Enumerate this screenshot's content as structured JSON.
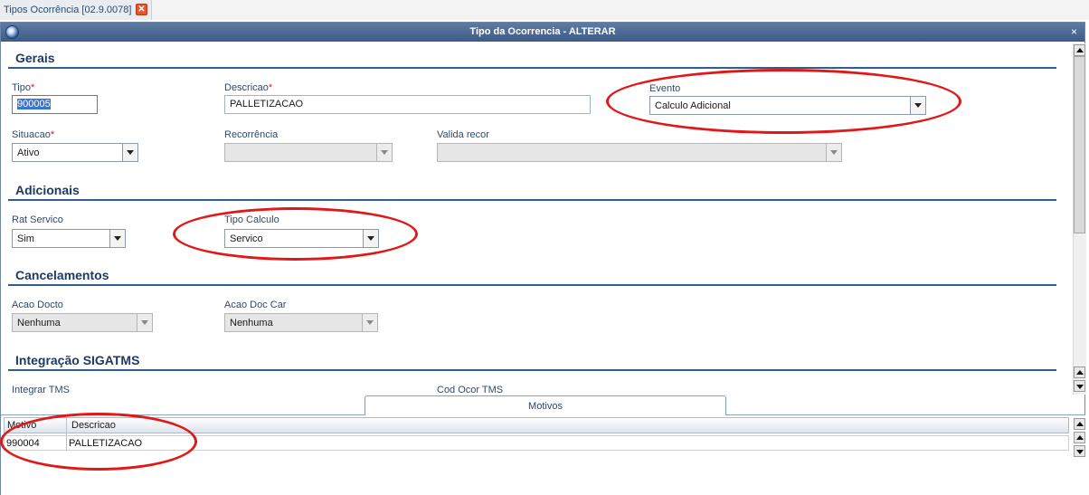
{
  "tab": {
    "label": "Tipos Ocorrência [02.9.0078]",
    "close_symbol": "✕"
  },
  "window": {
    "title": "Tipo da Ocorrencia - ALTERAR",
    "close_symbol": "×"
  },
  "sections": {
    "gerais": "Gerais",
    "adicionais": "Adicionais",
    "cancelamentos": "Cancelamentos",
    "integracao": "Integração SIGATMS"
  },
  "fields": {
    "tipo": {
      "label": "Tipo",
      "required_mark": "*",
      "value": "900005"
    },
    "descricao": {
      "label": "Descricao",
      "required_mark": "*",
      "value": "PALLETIZACAO"
    },
    "evento": {
      "label": "Evento",
      "value": "Calculo Adicional"
    },
    "situacao": {
      "label": "Situacao",
      "required_mark": "*",
      "value": "Ativo"
    },
    "recorrencia": {
      "label": "Recorrência",
      "value": ""
    },
    "valida_recor": {
      "label": "Valida recor",
      "value": ""
    },
    "rat_servico": {
      "label": "Rat Servico",
      "value": "Sim"
    },
    "tipo_calculo": {
      "label": "Tipo Calculo",
      "value": "Servico"
    },
    "acao_docto": {
      "label": "Acao Docto",
      "value": "Nenhuma"
    },
    "acao_doc_car": {
      "label": "Acao Doc Car",
      "value": "Nenhuma"
    },
    "integrar_tms": {
      "label": "Integrar TMS"
    },
    "cod_ocor_tms": {
      "label": "Cod Ocor TMS"
    }
  },
  "motivos": {
    "tab_label": "Motivos",
    "columns": [
      "Motivo",
      "Descricao"
    ],
    "rows": [
      [
        "990004",
        "PALLETIZACAO"
      ]
    ]
  },
  "colors": {
    "title_bar": "#3c5b86",
    "section_line": "#2f5f8a",
    "annotation": "#e01818",
    "required": "#d12020"
  },
  "icons": {
    "app_logo": "globe-logo-icon",
    "close": "close-icon",
    "dropdown": "chevron-down-icon"
  }
}
